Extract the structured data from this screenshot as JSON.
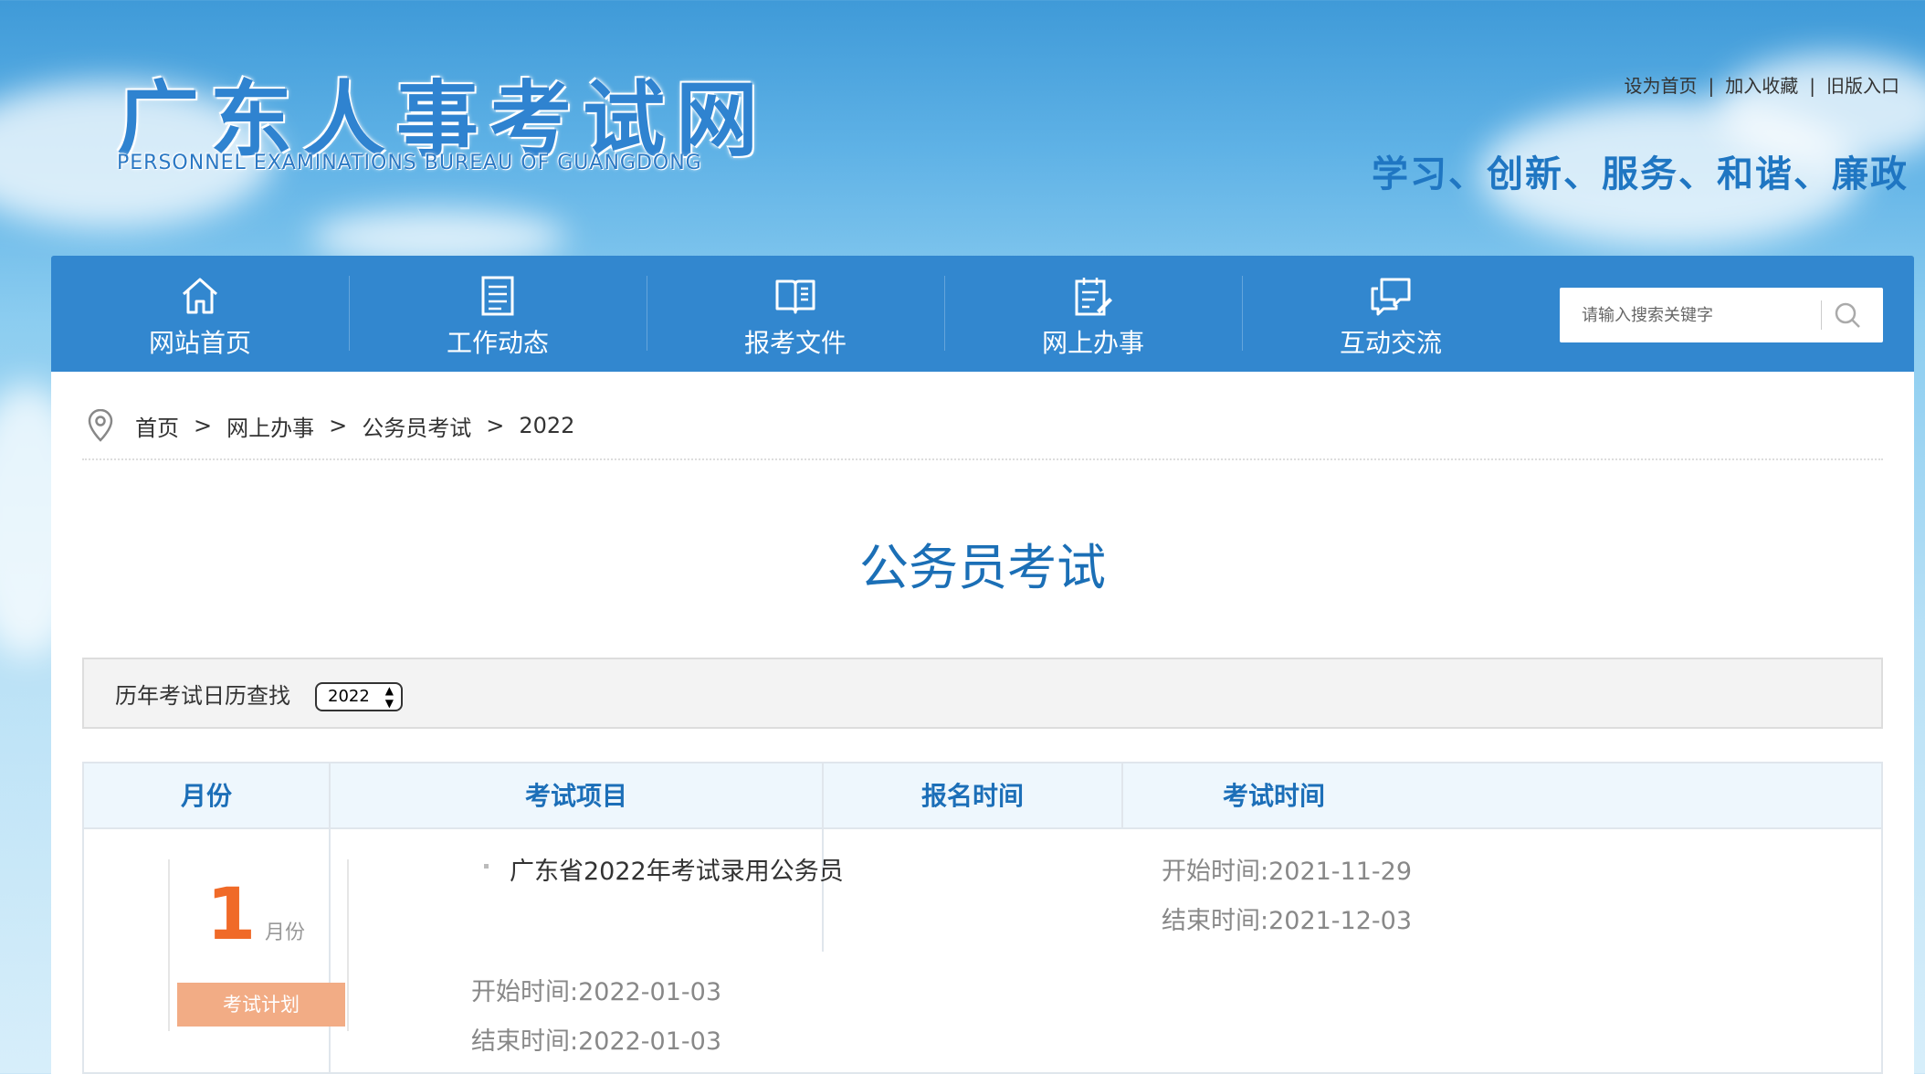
{
  "header": {
    "logo_cn": "广东人事考试网",
    "logo_en": "PERSONNEL EXAMINATIONS BUREAU OF GUANGDONG",
    "top_links": [
      "设为首页",
      "加入收藏",
      "旧版入口"
    ],
    "slogan": "学习、创新、服务、和谐、廉政"
  },
  "nav": {
    "items": [
      {
        "label": "网站首页",
        "icon": "home-icon"
      },
      {
        "label": "工作动态",
        "icon": "document-list-icon"
      },
      {
        "label": "报考文件",
        "icon": "open-book-icon"
      },
      {
        "label": "网上办事",
        "icon": "clipboard-edit-icon"
      },
      {
        "label": "互动交流",
        "icon": "chat-bubbles-icon"
      }
    ],
    "search_placeholder": "请输入搜索关键字"
  },
  "breadcrumb": [
    "首页",
    "网上办事",
    "公务员考试",
    "2022"
  ],
  "page_title": "公务员考试",
  "filter": {
    "label": "历年考试日历查找",
    "selected_year": "2022"
  },
  "table": {
    "headers": [
      "月份",
      "考试项目",
      "报名时间",
      "考试时间"
    ],
    "rows": [
      {
        "month": "1",
        "month_unit": "月份",
        "tag": "考试计划",
        "item": "广东省2022年考试录用公务员",
        "reg_start": "开始时间:2021-11-29",
        "reg_end": "结束时间:2021-12-03",
        "exam_start": "开始时间:2022-01-03",
        "exam_end": "结束时间:2022-01-03"
      }
    ]
  },
  "colors": {
    "nav_bg": "#3287cf",
    "title_blue": "#1b6fb6",
    "month_orange": "#f06a28",
    "tag_bg": "#f2ac85"
  }
}
